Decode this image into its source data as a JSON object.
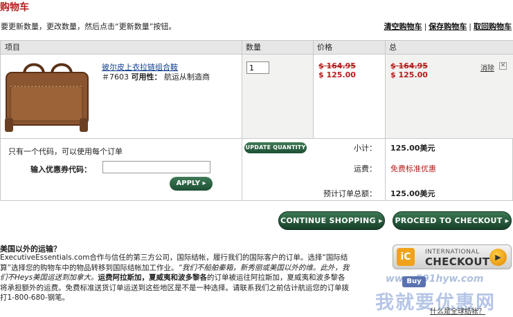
{
  "page": {
    "title": "购物车",
    "instruction": "要更新数量，更改数量，然后点击“更新数量”按钮。"
  },
  "top_links": [
    {
      "label": "清空购物车"
    },
    {
      "label": "保存购物车"
    },
    {
      "label": "取回购物车"
    }
  ],
  "table": {
    "headers": {
      "item": "项目",
      "quantity": "数量",
      "price": "价格",
      "total": "总"
    },
    "row": {
      "name": "彼尔皮上衣拉链组合鞍",
      "sku": "＃7603",
      "availability_label": "可用性：",
      "availability": "航运从制造商",
      "quantity": "1",
      "price_old": "$ 164.95",
      "price_new": "$ 125.00",
      "total_old": "$ 164.95",
      "total_new": "$ 125.00",
      "remove_label": "消除"
    },
    "update_button": "UPDATE QUANTITY"
  },
  "coupon": {
    "note": "只有一个代码，可以使用每个订单",
    "label": "输入优惠券代码：",
    "value": "",
    "apply_button": "APPLY ▸"
  },
  "summary": {
    "subtotal_label": "小计：",
    "subtotal_value": "125.00美元",
    "shipping_label": "运费：",
    "shipping_value": "免费标准优惠",
    "estimated_label": "预计订单总额：",
    "estimated_value": "125.00美元"
  },
  "buttons": {
    "continue": "CONTINUE SHOPPING ▸",
    "checkout": "PROCEED TO CHECKOUT ▸"
  },
  "international": {
    "title": "美国以外的运输？",
    "line1": "ExecutiveEssentials.com合作与信任的第三方公司，国际结帐，履行我们的国际客户的订单。选择“国际结",
    "line2a": "算”选择您的购物车中的物品转移到国际结帐加工作业。",
    "line2b": "“我们不船舶秦箱，新秀丽或美国以外的维。此外，我",
    "line3a": "们不Heys美国运送到加拿大。",
    "line3b": "运费阿拉斯加，夏威夷和波多黎各",
    "line3c": "的订单被运往阿拉斯加，夏威夷和波多黎各",
    "line4": "将承担额外的运费。免费标准送货订单运送到这些地区是不是一种选择。请联系我们之前估计航运您的订单拨",
    "line5": "打1-800-680-钢笔。",
    "badge_line1": "INTERNATIONAL",
    "badge_line2": "CHECKOUT",
    "buy_label": "Buy",
    "faq_link": "什么是全球结帐？"
  },
  "watermark": {
    "url": "www.591hyw.com",
    "text": "我就要优惠网"
  },
  "colors": {
    "accent_red": "#b71c1c",
    "button_green": "#1c4f33",
    "header_gray": "#e6e6e6"
  }
}
